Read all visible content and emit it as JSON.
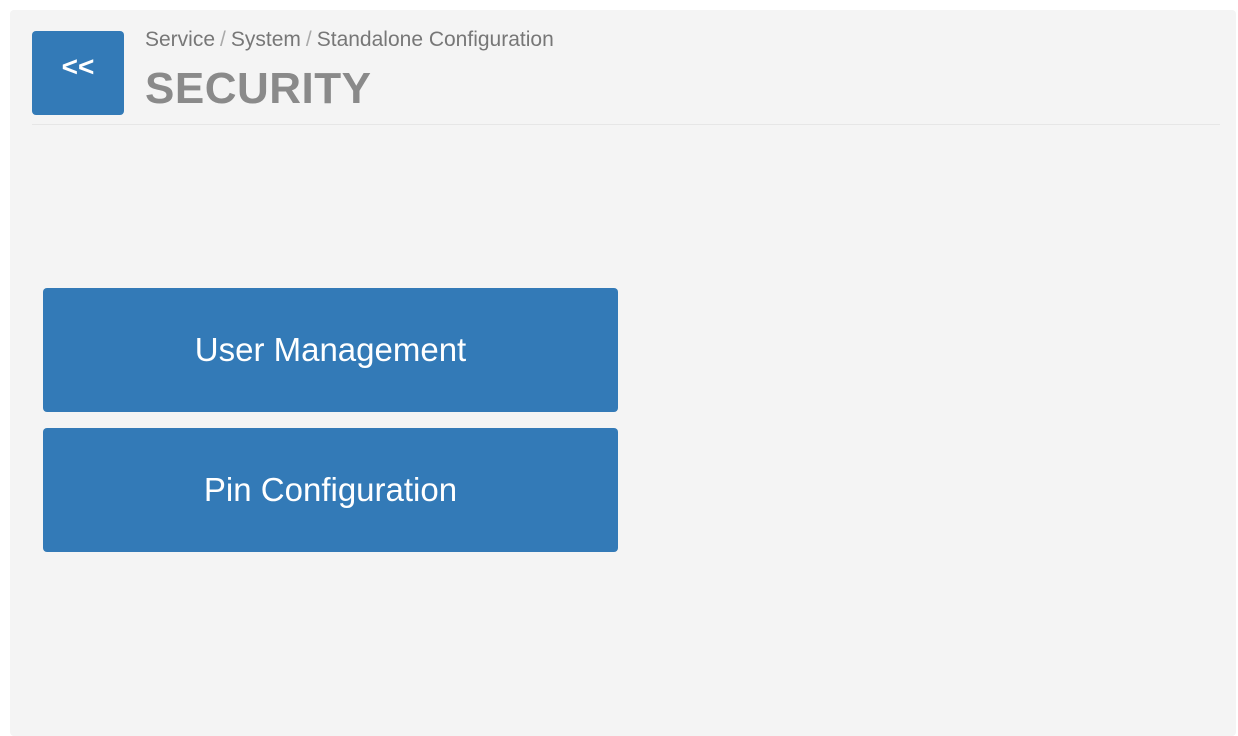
{
  "header": {
    "back_label": "<<",
    "breadcrumb": [
      "Service",
      "System",
      "Standalone Configuration"
    ],
    "breadcrumb_separator": "/",
    "title": "SECURITY"
  },
  "menu": {
    "items": [
      {
        "label": "User Management"
      },
      {
        "label": "Pin Configuration"
      }
    ]
  },
  "colors": {
    "accent": "#337ab7",
    "panel_background": "#f4f4f4",
    "title_text": "#8a8a8a"
  },
  "icons": {
    "back": "double-chevron-left-icon"
  }
}
